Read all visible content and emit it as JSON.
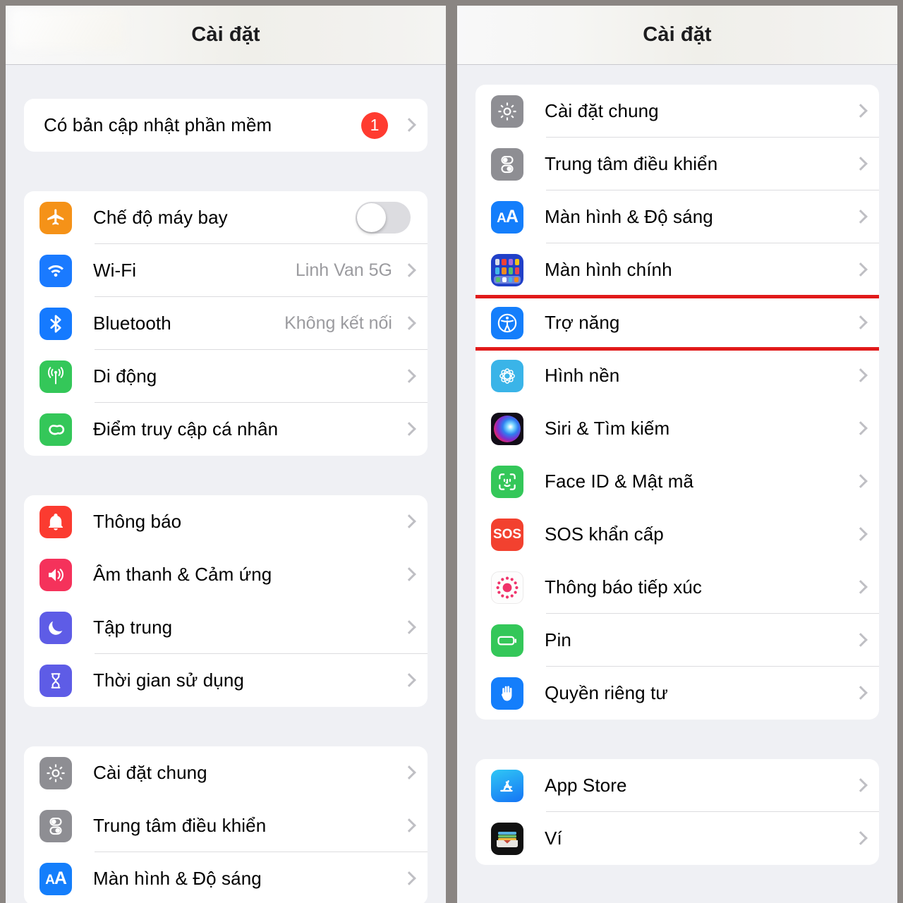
{
  "window": {
    "background": "#8a8582",
    "divider_color": "#8a8582"
  },
  "left_panel": {
    "title": "Cài đặt",
    "groups": [
      {
        "name": "software-update",
        "rows": [
          {
            "label": "Có bản cập nhật phần mềm",
            "badge": "1",
            "accessory": "chevron",
            "icon": null
          }
        ]
      },
      {
        "name": "connectivity",
        "rows": [
          {
            "label": "Chế độ máy bay",
            "icon": "airplane-icon",
            "icon_color": "#f59218",
            "accessory": "toggle",
            "toggle_on": false
          },
          {
            "label": "Wi-Fi",
            "icon": "wifi-icon",
            "icon_color": "#1a7 aff",
            "value": "Linh Van 5G",
            "accessory": "chevron"
          },
          {
            "label": "Bluetooth",
            "icon": "bluetooth-icon",
            "icon_color": "#157aff",
            "value": "Không kết nối",
            "accessory": "chevron"
          },
          {
            "label": "Di động",
            "icon": "cellular-icon",
            "icon_color": "#34c759",
            "accessory": "chevron"
          },
          {
            "label": "Điểm truy cập cá nhân",
            "icon": "hotspot-icon",
            "icon_color": "#34c759",
            "accessory": "chevron"
          }
        ]
      },
      {
        "name": "notifications",
        "rows": [
          {
            "label": "Thông báo",
            "icon": "bell-icon",
            "icon_color": "#fb3b30",
            "accessory": "chevron"
          },
          {
            "label": "Âm thanh & Cảm ứng",
            "icon": "speaker-icon",
            "icon_color": "#f5325b",
            "accessory": "chevron"
          },
          {
            "label": "Tập trung",
            "icon": "moon-icon",
            "icon_color": "#5e5ce6",
            "accessory": "chevron"
          },
          {
            "label": "Thời gian sử dụng",
            "icon": "hourglass-icon",
            "icon_color": "#5e5ce6",
            "accessory": "chevron"
          }
        ]
      },
      {
        "name": "system",
        "rows": [
          {
            "label": "Cài đặt chung",
            "icon": "gear-icon",
            "icon_color": "#8e8e93",
            "accessory": "chevron"
          },
          {
            "label": "Trung tâm điều khiển",
            "icon": "control-center-icon",
            "icon_color": "#8e8e93",
            "accessory": "chevron"
          },
          {
            "label": "Màn hình & Độ sáng",
            "icon": "display-aa-icon",
            "icon_color": "#147efb",
            "accessory": "chevron"
          }
        ]
      }
    ]
  },
  "right_panel": {
    "title": "Cài đặt",
    "highlighted_row": "Trợ năng",
    "highlight_color": "#e11a1a",
    "groups": [
      {
        "name": "system",
        "rows": [
          {
            "label": "Cài đặt chung",
            "icon": "gear-icon",
            "icon_color": "#8e8e93",
            "accessory": "chevron"
          },
          {
            "label": "Trung tâm điều khiển",
            "icon": "control-center-icon",
            "icon_color": "#8e8e93",
            "accessory": "chevron"
          },
          {
            "label": "Màn hình & Độ sáng",
            "icon": "display-aa-icon",
            "icon_color": "#147efb",
            "accessory": "chevron"
          },
          {
            "label": "Màn hình chính",
            "icon": "home-screen-icon",
            "icon_color": "#2140c8",
            "accessory": "chevron"
          },
          {
            "label": "Trợ năng",
            "icon": "accessibility-icon",
            "icon_color": "#147efb",
            "accessory": "chevron",
            "highlighted": true
          },
          {
            "label": "Hình nền",
            "icon": "wallpaper-icon",
            "icon_color": "#3ab4e8",
            "accessory": "chevron"
          },
          {
            "label": "Siri & Tìm kiếm",
            "icon": "siri-icon",
            "icon_color": "#1b1b24",
            "accessory": "chevron"
          },
          {
            "label": "Face ID & Mật mã",
            "icon": "face-id-icon",
            "icon_color": "#34c759",
            "accessory": "chevron"
          },
          {
            "label": "SOS khẩn cấp",
            "icon": "sos-icon",
            "icon_color": "#f2412f",
            "accessory": "chevron"
          },
          {
            "label": "Thông báo tiếp xúc",
            "icon": "exposure-notification-icon",
            "icon_color": "#ffffff",
            "accessory": "chevron"
          },
          {
            "label": "Pin",
            "icon": "battery-icon",
            "icon_color": "#34c759",
            "accessory": "chevron"
          },
          {
            "label": "Quyền riêng tư",
            "icon": "privacy-hand-icon",
            "icon_color": "#147efb",
            "accessory": "chevron"
          }
        ]
      },
      {
        "name": "stores",
        "rows": [
          {
            "label": "App Store",
            "icon": "app-store-icon",
            "icon_color": "#1d9bf8",
            "accessory": "chevron"
          },
          {
            "label": "Ví",
            "icon": "wallet-icon",
            "icon_color": "#111111",
            "accessory": "chevron"
          }
        ]
      }
    ]
  }
}
